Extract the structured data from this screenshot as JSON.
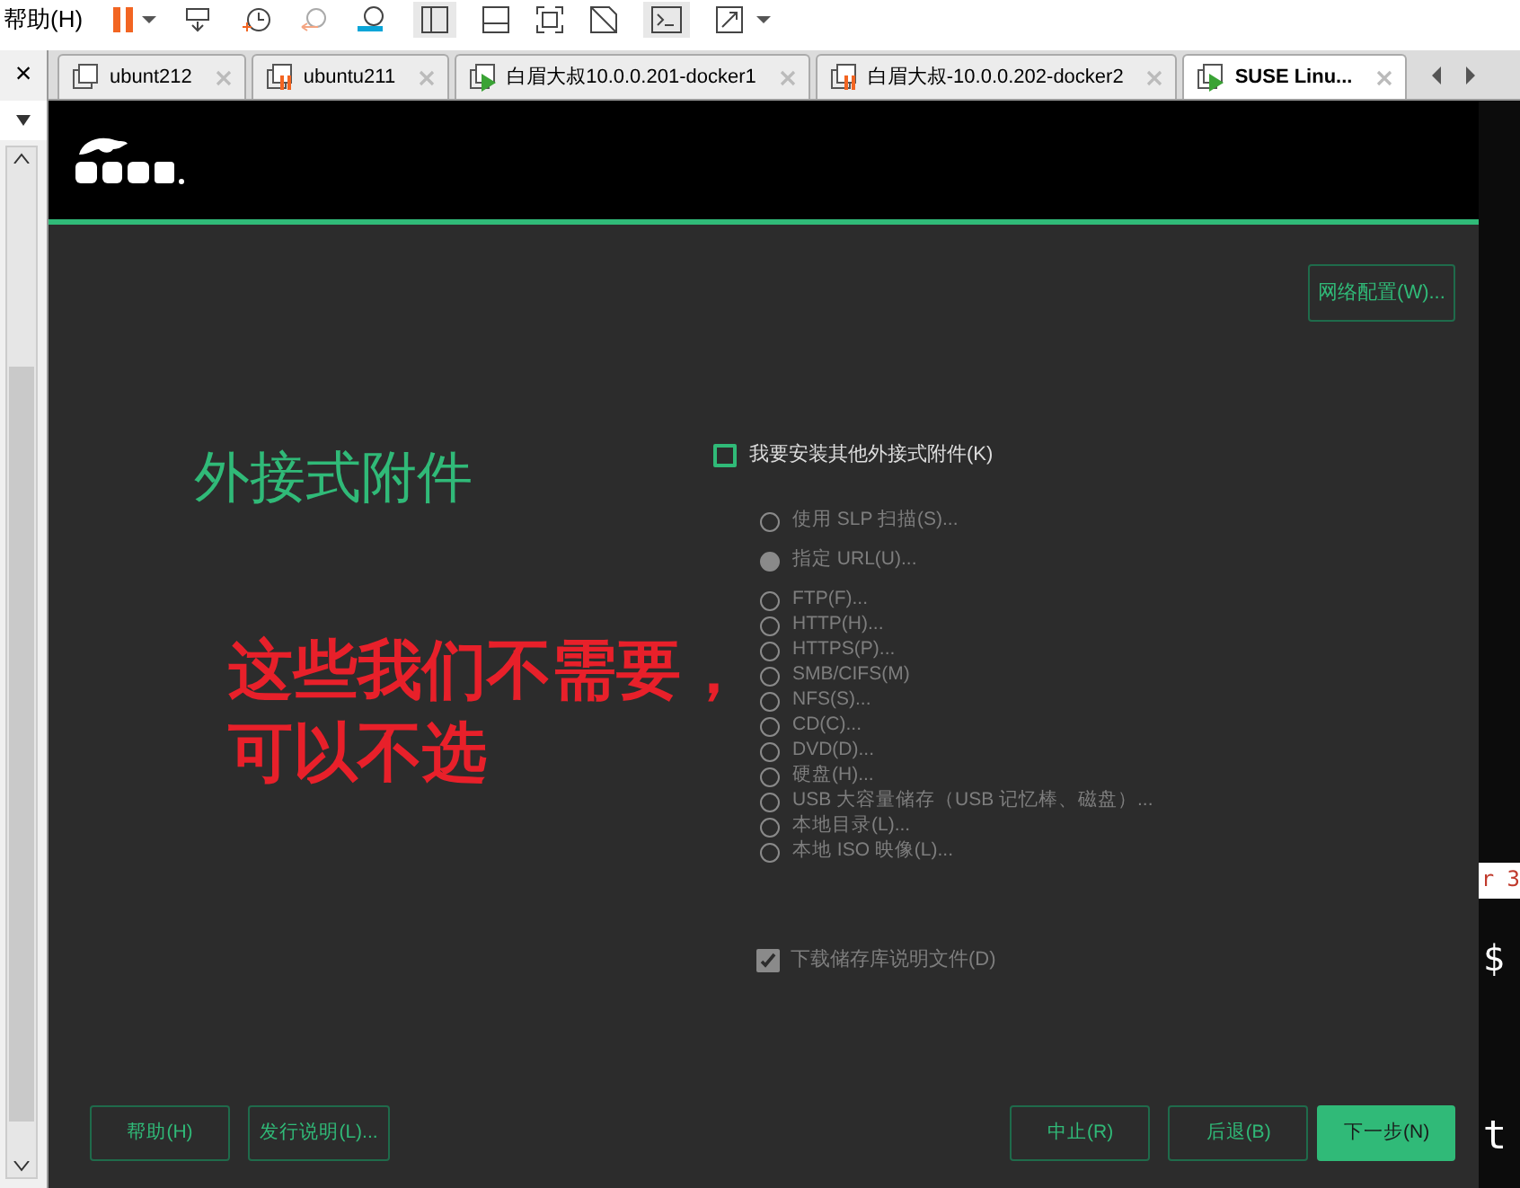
{
  "menu": {
    "label": "帮助(H)"
  },
  "library": {
    "close": "×"
  },
  "tabs": [
    {
      "label": "ubunt212",
      "selected": false,
      "kind": "off"
    },
    {
      "label": "ubuntu211",
      "selected": false,
      "kind": "paused"
    },
    {
      "label": "白眉大叔10.0.0.201-docker1",
      "selected": false,
      "kind": "running"
    },
    {
      "label": "白眉大叔-10.0.0.202-docker2",
      "selected": false,
      "kind": "paused"
    },
    {
      "label": "SUSE Linu...",
      "selected": true,
      "kind": "running"
    }
  ],
  "installer": {
    "network_button": "网络配置(W)...",
    "title": "外接式附件",
    "addon_checkbox": {
      "label": "我要安装其他外接式附件(K)",
      "checked": false
    },
    "sources": [
      {
        "label": "使用 SLP 扫描(S)...",
        "selected": false,
        "disabled": true
      },
      {
        "label": "指定 URL(U)...",
        "selected": true,
        "disabled": true
      },
      {
        "label": "FTP(F)...",
        "selected": false,
        "disabled": true
      },
      {
        "label": "HTTP(H)...",
        "selected": false,
        "disabled": true
      },
      {
        "label": "HTTPS(P)...",
        "selected": false,
        "disabled": true
      },
      {
        "label": "SMB/CIFS(M)",
        "selected": false,
        "disabled": true
      },
      {
        "label": "NFS(S)...",
        "selected": false,
        "disabled": true
      },
      {
        "label": "CD(C)...",
        "selected": false,
        "disabled": true
      },
      {
        "label": "DVD(D)...",
        "selected": false,
        "disabled": true
      },
      {
        "label": "硬盘(H)...",
        "selected": false,
        "disabled": true
      },
      {
        "label": "USB 大容量储存（USB 记忆棒、磁盘）...",
        "selected": false,
        "disabled": true
      },
      {
        "label": "本地目录(L)...",
        "selected": false,
        "disabled": true
      },
      {
        "label": "本地 ISO 映像(L)...",
        "selected": false,
        "disabled": true
      }
    ],
    "download_checkbox": {
      "label": "下载储存库说明文件(D)",
      "checked": true,
      "disabled": true
    },
    "buttons": [
      {
        "label": "帮助(H)",
        "kind": "outline"
      },
      {
        "label": "发行说明(L)...",
        "kind": "outline"
      },
      {
        "label": "中止(R)",
        "kind": "outline"
      },
      {
        "label": "后退(B)",
        "kind": "outline"
      },
      {
        "label": "下一步(N)",
        "kind": "primary"
      }
    ]
  },
  "annotation": [
    "这些我们不需要，",
    "可以不选"
  ],
  "terminal": [
    "r 3",
    "$",
    "t"
  ]
}
